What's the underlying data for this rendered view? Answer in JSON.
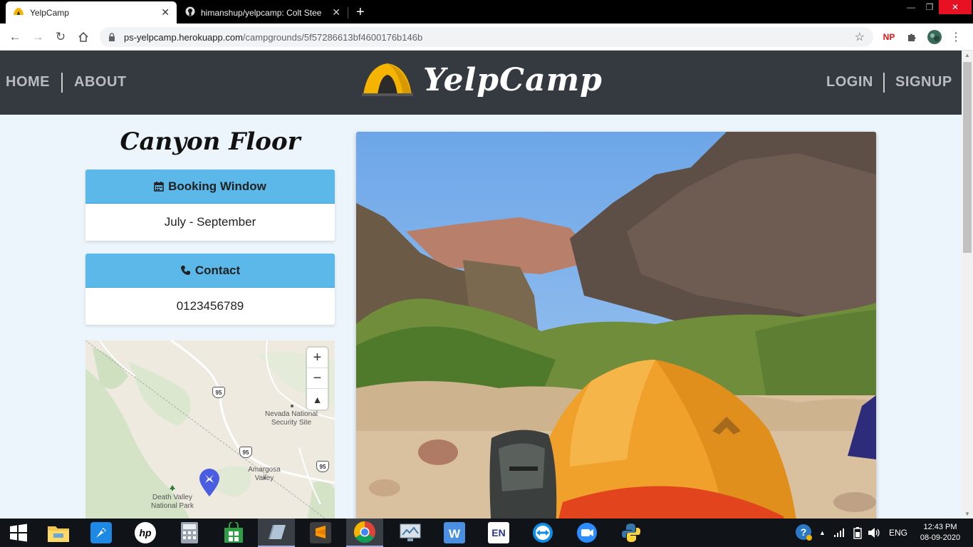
{
  "browser": {
    "tabs": [
      {
        "title": "YelpCamp",
        "active": true
      },
      {
        "title": "himanshup/yelpcamp: Colt Steele",
        "active": false
      }
    ],
    "new_tab": "+",
    "close_glyph": "✕",
    "url_host": "ps-yelpcamp.herokuapp.com",
    "url_path": "/campgrounds/5f57286613bf4600176b146b",
    "extensions": {
      "np": "NP"
    }
  },
  "navbar": {
    "home": "HOME",
    "about": "ABOUT",
    "brand": "YelpCamp",
    "login": "LOGIN",
    "signup": "SIGNUP"
  },
  "campground": {
    "title": "Canyon Floor",
    "booking_label": "Booking Window",
    "booking_value": "July - September",
    "contact_label": "Contact",
    "contact_value": "0123456789"
  },
  "map": {
    "zoom_in": "+",
    "zoom_out": "−",
    "reset": "▲",
    "labels": {
      "nevada": "Nevada National Security Site",
      "amargosa": "Amargosa Valley",
      "death_valley": "Death Valley National Park"
    },
    "route": "95"
  },
  "taskbar": {
    "lang": "ENG",
    "time": "12:43 PM",
    "date": "08-09-2020",
    "en_label": "EN"
  },
  "colors": {
    "navbar": "#343a40",
    "page_bg": "#ecf5fc",
    "card_header": "#5bb8e8"
  }
}
